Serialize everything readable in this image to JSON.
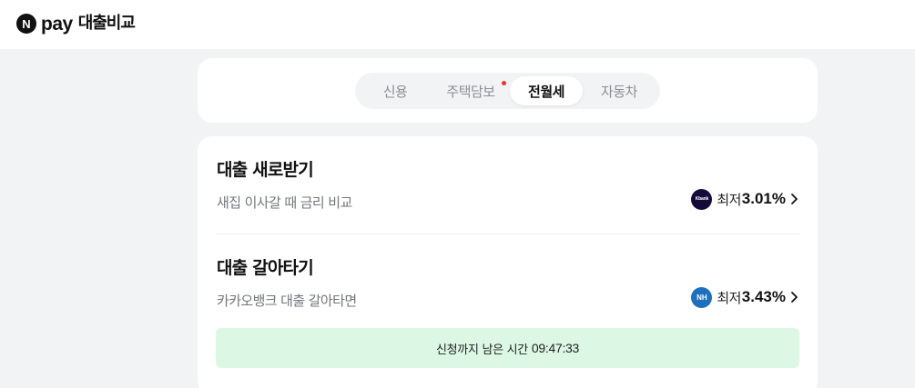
{
  "header": {
    "logo_letter": "N",
    "pay_word": "pay",
    "service_name": "대출비교"
  },
  "tabs": [
    {
      "label": "신용",
      "selected": false,
      "new_dot": false
    },
    {
      "label": "주택담보",
      "selected": false,
      "new_dot": true
    },
    {
      "label": "전월세",
      "selected": true,
      "new_dot": false
    },
    {
      "label": "자동차",
      "selected": false,
      "new_dot": false
    }
  ],
  "offers": [
    {
      "title": "대출 새로받기",
      "subtitle": "새집 이사갈 때 금리 비교",
      "bank_logo_text": "Kbank",
      "bank_icon": "kbank-logo-icon",
      "rate_prefix": "최저",
      "rate_value": "3.01%"
    },
    {
      "title": "대출 갈아타기",
      "subtitle": "카카오뱅크 대출 갈아타면",
      "bank_logo_text": "NH",
      "bank_icon": "nh-logo-icon",
      "rate_prefix": "최저",
      "rate_value": "3.43%"
    }
  ],
  "timer": {
    "label": "신청까지 남은 시간",
    "time": "09:47:33"
  },
  "colors": {
    "page_background": "#f2f3f5",
    "card_background": "#ffffff",
    "selected_tab_text": "#111111",
    "unselected_tab_text": "#8b8e94",
    "new_dot": "#f0332c",
    "timer_background": "#dcf7e3",
    "kbank_logo": "#150b3b",
    "nh_logo": "#1d6fc0"
  }
}
